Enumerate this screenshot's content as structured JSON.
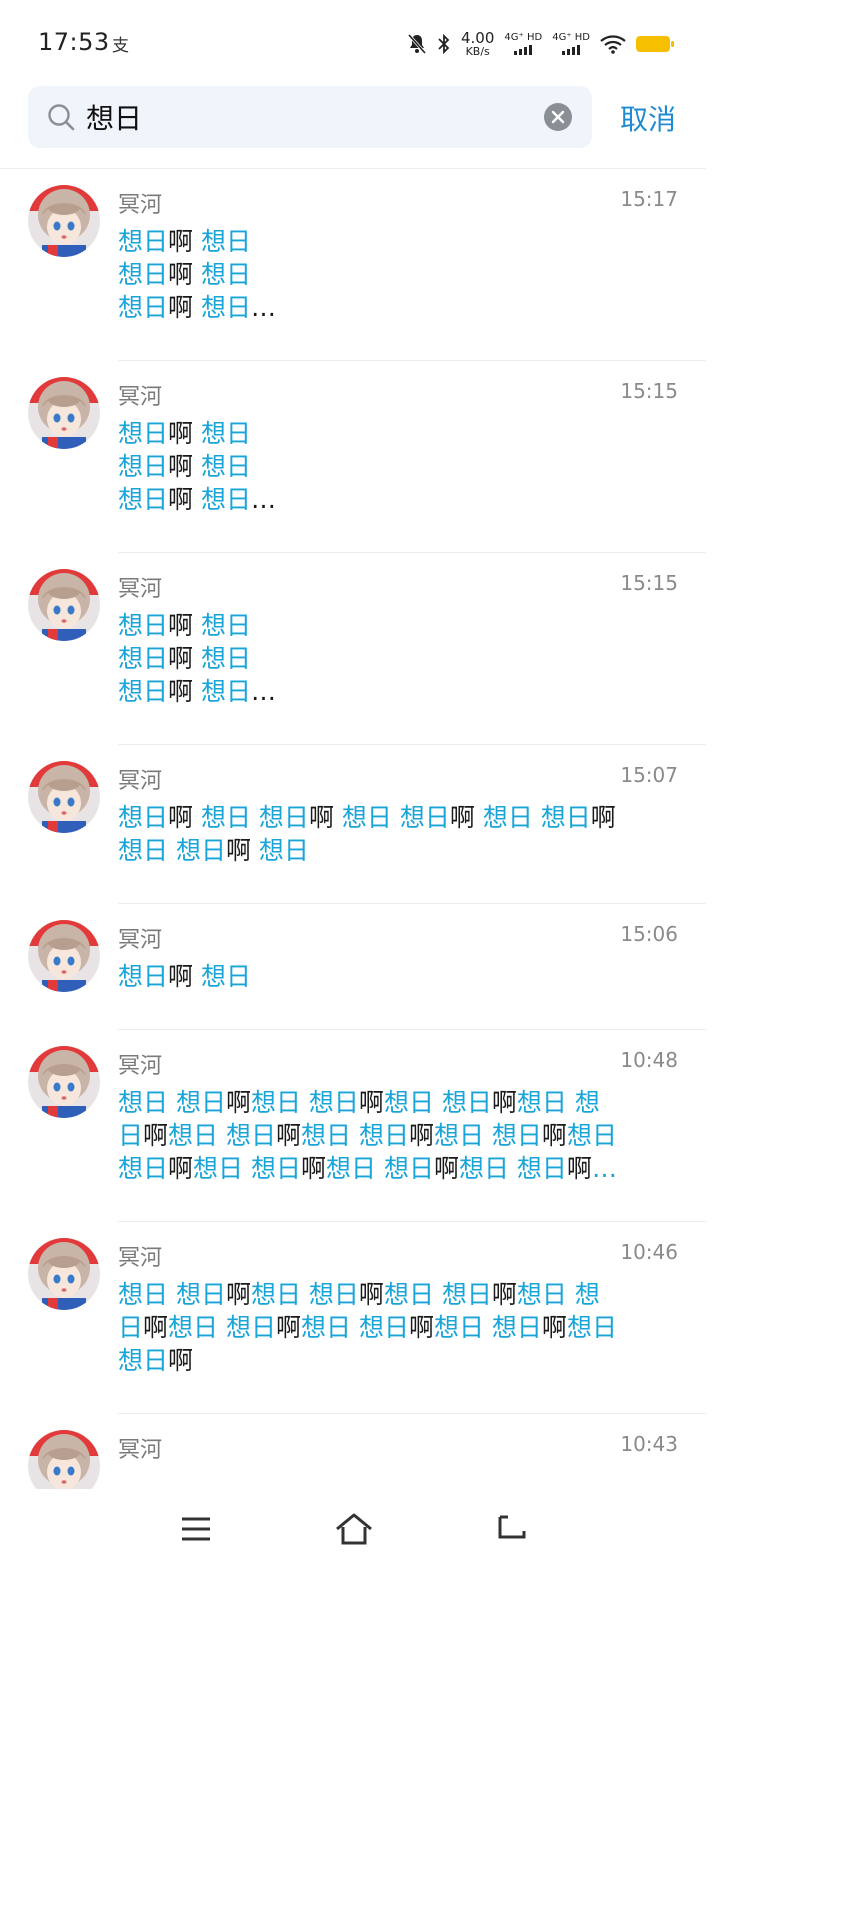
{
  "status_bar": {
    "time": "17:53",
    "alipay_glyph": "支",
    "net_speed_value": "4.00",
    "net_speed_unit": "KB/s",
    "sim1_label": "4G⁺ HD",
    "sim2_label": "4G⁺ HD",
    "icons": [
      "mute-icon",
      "bluetooth-icon",
      "wifi-icon",
      "battery-icon"
    ],
    "battery_color": "#f6c000"
  },
  "search": {
    "query": "想日",
    "cancel_label": "取消"
  },
  "results": [
    {
      "sender": "冥河",
      "time": "15:17",
      "lines": [
        [
          {
            "t": "想日",
            "h": true
          },
          {
            "t": "啊 ",
            "h": false
          },
          {
            "t": "想日",
            "h": true
          }
        ],
        [
          {
            "t": "想日",
            "h": true
          },
          {
            "t": "啊 ",
            "h": false
          },
          {
            "t": "想日",
            "h": true
          }
        ],
        [
          {
            "t": "想日",
            "h": true
          },
          {
            "t": "啊 ",
            "h": false
          },
          {
            "t": "想日",
            "h": true
          },
          {
            "t": "…",
            "h": false
          }
        ]
      ]
    },
    {
      "sender": "冥河",
      "time": "15:15",
      "lines": [
        [
          {
            "t": "想日",
            "h": true
          },
          {
            "t": "啊 ",
            "h": false
          },
          {
            "t": "想日",
            "h": true
          }
        ],
        [
          {
            "t": "想日",
            "h": true
          },
          {
            "t": "啊 ",
            "h": false
          },
          {
            "t": "想日",
            "h": true
          }
        ],
        [
          {
            "t": "想日",
            "h": true
          },
          {
            "t": "啊 ",
            "h": false
          },
          {
            "t": "想日",
            "h": true
          },
          {
            "t": "…",
            "h": false
          }
        ]
      ]
    },
    {
      "sender": "冥河",
      "time": "15:15",
      "lines": [
        [
          {
            "t": "想日",
            "h": true
          },
          {
            "t": "啊 ",
            "h": false
          },
          {
            "t": "想日",
            "h": true
          }
        ],
        [
          {
            "t": "想日",
            "h": true
          },
          {
            "t": "啊 ",
            "h": false
          },
          {
            "t": "想日",
            "h": true
          }
        ],
        [
          {
            "t": "想日",
            "h": true
          },
          {
            "t": "啊 ",
            "h": false
          },
          {
            "t": "想日",
            "h": true
          },
          {
            "t": "…",
            "h": false
          }
        ]
      ]
    },
    {
      "sender": "冥河",
      "time": "15:07",
      "lines": [
        [
          {
            "t": "想日",
            "h": true
          },
          {
            "t": "啊 ",
            "h": false
          },
          {
            "t": "想日 ",
            "h": true
          },
          {
            "t": "想日",
            "h": true
          },
          {
            "t": "啊 ",
            "h": false
          },
          {
            "t": "想日 ",
            "h": true
          },
          {
            "t": "想日",
            "h": true
          },
          {
            "t": "啊 ",
            "h": false
          },
          {
            "t": "想日 ",
            "h": true
          },
          {
            "t": "想日",
            "h": true
          },
          {
            "t": "啊",
            "h": false
          }
        ],
        [
          {
            "t": "想日 ",
            "h": true
          },
          {
            "t": "想日",
            "h": true
          },
          {
            "t": "啊 ",
            "h": false
          },
          {
            "t": "想日",
            "h": true
          }
        ]
      ]
    },
    {
      "sender": "冥河",
      "time": "15:06",
      "lines": [
        [
          {
            "t": "想日",
            "h": true
          },
          {
            "t": "啊 ",
            "h": false
          },
          {
            "t": "想日",
            "h": true
          }
        ]
      ]
    },
    {
      "sender": "冥河",
      "time": "10:48",
      "lines": [
        [
          {
            "t": "想日 想日",
            "h": true
          },
          {
            "t": "啊",
            "h": false
          },
          {
            "t": "想日 想日",
            "h": true
          },
          {
            "t": "啊",
            "h": false
          },
          {
            "t": "想日 想日",
            "h": true
          },
          {
            "t": "啊",
            "h": false
          },
          {
            "t": "想日 想",
            "h": true
          }
        ],
        [
          {
            "t": "日",
            "h": true
          },
          {
            "t": "啊",
            "h": false
          },
          {
            "t": "想日 想日",
            "h": true
          },
          {
            "t": "啊",
            "h": false
          },
          {
            "t": "想日 想日",
            "h": true
          },
          {
            "t": "啊",
            "h": false
          },
          {
            "t": "想日 想日",
            "h": true
          },
          {
            "t": "啊",
            "h": false
          },
          {
            "t": "想日",
            "h": true
          }
        ],
        [
          {
            "t": "想日",
            "h": true
          },
          {
            "t": "啊",
            "h": false
          },
          {
            "t": "想日 想日",
            "h": true
          },
          {
            "t": "啊",
            "h": false
          },
          {
            "t": "想日 想日",
            "h": true
          },
          {
            "t": "啊",
            "h": false
          },
          {
            "t": "想日 想日",
            "h": true
          },
          {
            "t": "啊",
            "h": false
          },
          {
            "t": "…",
            "h": true
          }
        ]
      ]
    },
    {
      "sender": "冥河",
      "time": "10:46",
      "lines": [
        [
          {
            "t": "想日 想日",
            "h": true
          },
          {
            "t": "啊",
            "h": false
          },
          {
            "t": "想日 想日",
            "h": true
          },
          {
            "t": "啊",
            "h": false
          },
          {
            "t": "想日 想日",
            "h": true
          },
          {
            "t": "啊",
            "h": false
          },
          {
            "t": "想日 想",
            "h": true
          }
        ],
        [
          {
            "t": "日",
            "h": true
          },
          {
            "t": "啊",
            "h": false
          },
          {
            "t": "想日 想日",
            "h": true
          },
          {
            "t": "啊",
            "h": false
          },
          {
            "t": "想日 想日",
            "h": true
          },
          {
            "t": "啊",
            "h": false
          },
          {
            "t": "想日 想日",
            "h": true
          },
          {
            "t": "啊",
            "h": false
          },
          {
            "t": "想日",
            "h": true
          }
        ],
        [
          {
            "t": "想日",
            "h": true
          },
          {
            "t": "啊",
            "h": false
          }
        ]
      ]
    },
    {
      "sender": "冥河",
      "time": "10:43",
      "lines": []
    }
  ],
  "nav": {
    "icons": [
      "menu-icon",
      "home-icon",
      "back-icon"
    ]
  },
  "colors": {
    "highlight": "#19a5d8",
    "accent": "#1f8bd0",
    "text": "#1a1a1a"
  }
}
